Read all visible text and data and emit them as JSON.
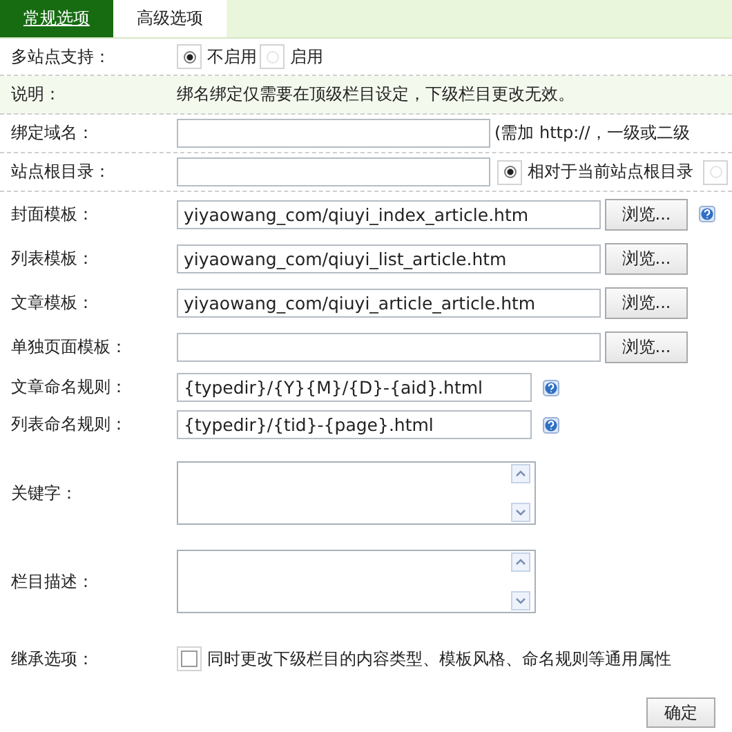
{
  "tabs": [
    {
      "label": "常规选项",
      "selected": true
    },
    {
      "label": "高级选项",
      "selected": false
    }
  ],
  "rows": [
    {
      "kind": "radio",
      "label": "多站点支持：",
      "options": [
        {
          "label": "不启用",
          "selected": true
        },
        {
          "label": "启用",
          "selected": false
        }
      ]
    },
    {
      "kind": "note",
      "label": "说明：",
      "text": "绑名绑定仅需要在顶级栏目设定，下级栏目更改无效。"
    },
    {
      "kind": "text",
      "label": "绑定域名：",
      "hint": "(需加 http://，一级或二级"
    },
    {
      "kind": "text_radio",
      "label": "站点根目录：",
      "options": [
        {
          "label": "相对于当前站点根目录",
          "selected": true
        },
        {
          "selected": false
        }
      ]
    },
    {
      "kind": "template",
      "label": "封面模板：",
      "value": "yiyaowang_com/qiuyi_index_article.htm",
      "button": "浏览...",
      "help": true
    },
    {
      "kind": "template",
      "label": "列表模板：",
      "value": "yiyaowang_com/qiuyi_list_article.htm",
      "button": "浏览...",
      "help": false
    },
    {
      "kind": "template",
      "label": "文章模板：",
      "value": "yiyaowang_com/qiuyi_article_article.htm",
      "button": "浏览...",
      "help": false
    },
    {
      "kind": "template",
      "label": "单独页面模板：",
      "button": "浏览...",
      "help": false
    },
    {
      "kind": "rule",
      "label": "文章命名规则：",
      "value": "{typedir}/{Y}{M}/{D}-{aid}.html",
      "help": true
    },
    {
      "kind": "rule",
      "label": "列表命名规则：",
      "value": "{typedir}/{tid}-{page}.html",
      "help": true
    },
    {
      "kind": "textarea",
      "label": "关键字："
    },
    {
      "kind": "textarea",
      "label": "栏目描述："
    },
    {
      "kind": "checkbox",
      "label": "继承选项：",
      "text": "同时更改下级栏目的内容类型、模板风格、命名规则等通用属性",
      "checked": false
    }
  ],
  "submit": "确定"
}
